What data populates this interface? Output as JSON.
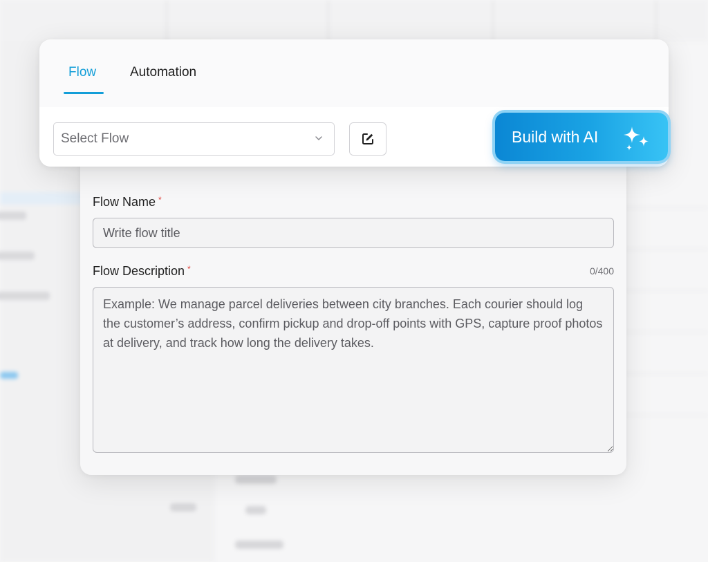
{
  "tabs": [
    {
      "label": "Flow",
      "active": true
    },
    {
      "label": "Automation",
      "active": false
    }
  ],
  "toolbar": {
    "select_placeholder": "Select Flow",
    "edit_icon": "edit-icon",
    "build_ai_label": "Build with AI",
    "build_ai_icon": "sparkle-icon"
  },
  "form": {
    "name_label": "Flow Name",
    "name_placeholder": "Write flow title",
    "description_label": "Flow Description",
    "description_counter": "0/400",
    "description_placeholder": "Example: We manage parcel deliveries between city branches. Each courier should log the customer’s address, confirm pickup and drop-off points with GPS, capture proof photos at delivery, and track how long the delivery takes.",
    "required_marker": "*"
  },
  "colors": {
    "accent": "#139ed8",
    "ai_gradient_start": "#0b87d4",
    "ai_gradient_end": "#38c3f5",
    "required": "#e0403a"
  }
}
